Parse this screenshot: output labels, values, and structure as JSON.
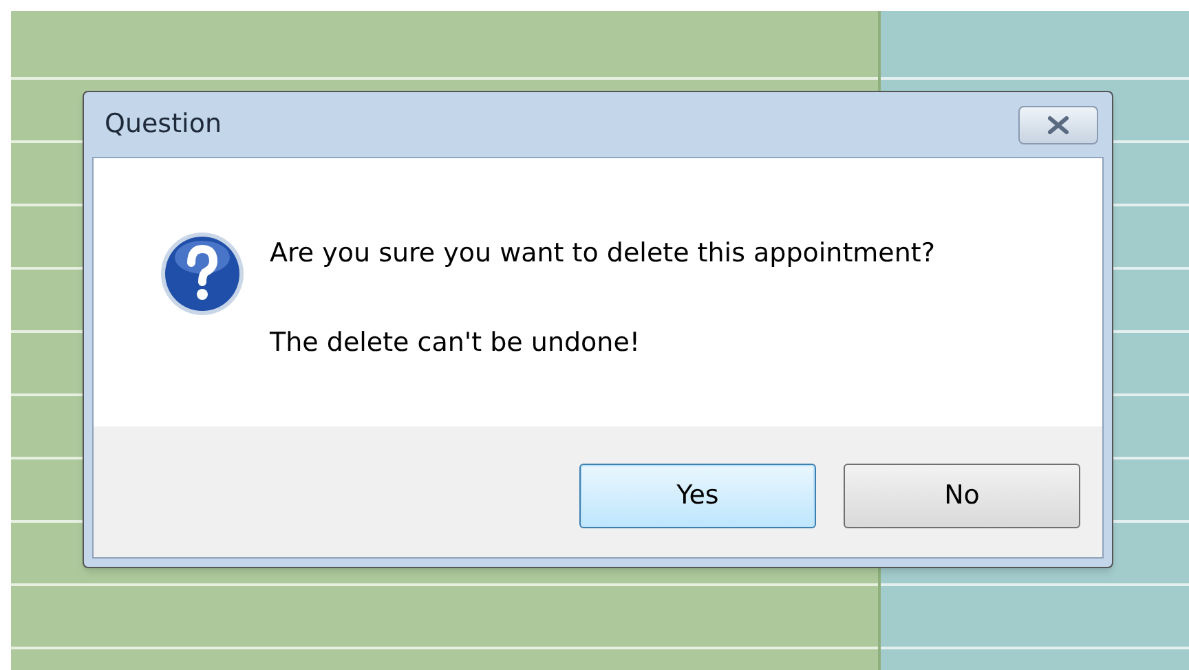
{
  "window": {
    "title": "Question"
  },
  "message": [
    "Are you sure you want to delete this appointment?",
    "The delete can't be undone!"
  ],
  "buttons": [
    {
      "label": "Yes",
      "selected": true
    },
    {
      "label": "No",
      "selected": false
    }
  ]
}
